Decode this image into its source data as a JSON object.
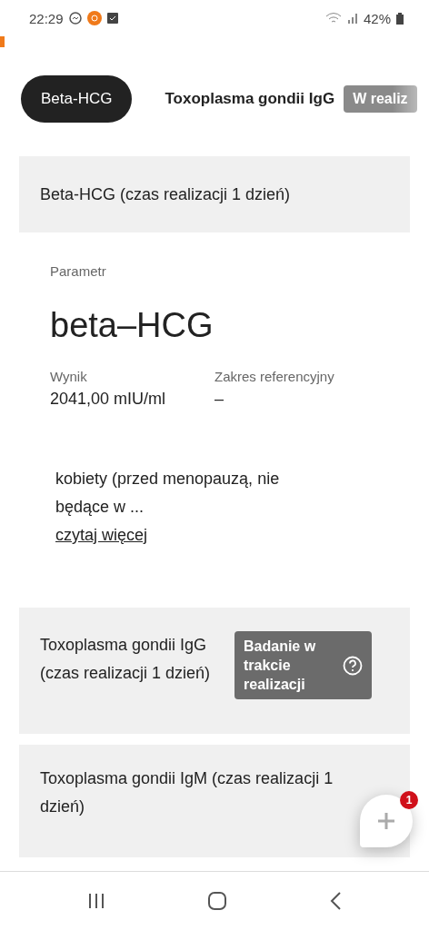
{
  "status_bar": {
    "time": "22:29",
    "battery": "42%"
  },
  "tabs": [
    {
      "label": "Beta-HCG",
      "selected": true
    },
    {
      "label": "Toxoplasma gondii IgG",
      "selected": false,
      "badge": "W realiz"
    }
  ],
  "result": {
    "header": "Beta-HCG (czas realizacji 1 dzień)",
    "param_label": "Parametr",
    "param_name": "beta–HCG",
    "value_label": "Wynik",
    "value": "2041,00 mIU/ml",
    "range_label": "Zakres referencyjny",
    "range": "–",
    "note": "kobiety (przed menopauzą, nie będące w ...",
    "more_link": "czytaj więcej"
  },
  "tests": [
    {
      "title": "Toxoplasma gondii IgG (czas realizacji 1 dzień)",
      "status": "Badanie w trakcie realizacji"
    },
    {
      "title": "Toxoplasma gondii IgM (czas realizacji 1 dzień)"
    }
  ],
  "chat": {
    "badge": "1"
  }
}
